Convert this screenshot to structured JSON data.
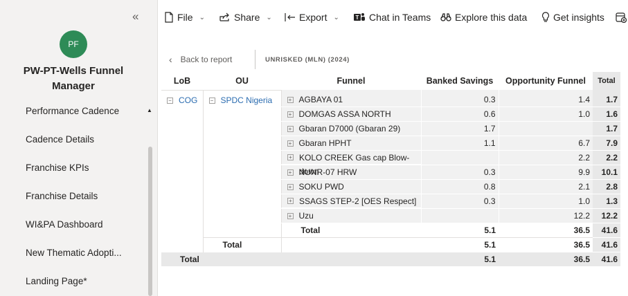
{
  "sidebar": {
    "avatar_initials": "PF",
    "app_title": "PW-PT-Wells Funnel Manager",
    "items": [
      {
        "label": "Performance Cadence"
      },
      {
        "label": "Cadence Details"
      },
      {
        "label": "Franchise KPIs"
      },
      {
        "label": "Franchise Details"
      },
      {
        "label": "WI&PA Dashboard"
      },
      {
        "label": "New Thematic Adopti..."
      },
      {
        "label": "Landing Page*"
      }
    ]
  },
  "toolbar": {
    "file": "File",
    "share": "Share",
    "export": "Export",
    "chat": "Chat in Teams",
    "explore": "Explore this data",
    "insights": "Get insights"
  },
  "report": {
    "back_label": "Back to report",
    "title": "UNRISKED (MLN) (2024)"
  },
  "matrix": {
    "headers": {
      "lob": "LoB",
      "ou": "OU",
      "funnel": "Funnel",
      "banked": "Banked Savings",
      "opportunity": "Opportunity Funnel",
      "total": "Total"
    },
    "lob": "COG",
    "ou": "SPDC Nigeria",
    "rows": [
      {
        "funnel": "AGBAYA 01",
        "banked": "0.3",
        "opportunity": "1.4",
        "total": "1.7"
      },
      {
        "funnel": "DOMGAS ASSA NORTH",
        "banked": "0.6",
        "opportunity": "1.0",
        "total": "1.6"
      },
      {
        "funnel": "Gbaran D7000 (Gbaran 29)",
        "banked": "1.7",
        "opportunity": "",
        "total": "1.7"
      },
      {
        "funnel": "Gbaran HPHT",
        "banked": "1.1",
        "opportunity": "6.7",
        "total": "7.9"
      },
      {
        "funnel": "KOLO CREEK Gas cap Blow-down",
        "banked": "",
        "opportunity": "2.2",
        "total": "2.2"
      },
      {
        "funnel": "NUNR-07 HRW",
        "banked": "0.3",
        "opportunity": "9.9",
        "total": "10.1"
      },
      {
        "funnel": "SOKU PWD",
        "banked": "0.8",
        "opportunity": "2.1",
        "total": "2.8"
      },
      {
        "funnel": "SSAGS STEP-2 [OES Respect]",
        "banked": "0.3",
        "opportunity": "1.0",
        "total": "1.3"
      },
      {
        "funnel": "Uzu",
        "banked": "",
        "opportunity": "12.2",
        "total": "12.2"
      }
    ],
    "funnel_total": {
      "label": "Total",
      "banked": "5.1",
      "opportunity": "36.5",
      "total": "41.6"
    },
    "ou_total": {
      "label": "Total",
      "banked": "5.1",
      "opportunity": "36.5",
      "total": "41.6"
    },
    "grand_total": {
      "label": "Total",
      "banked": "5.1",
      "opportunity": "36.5",
      "total": "41.6"
    }
  }
}
